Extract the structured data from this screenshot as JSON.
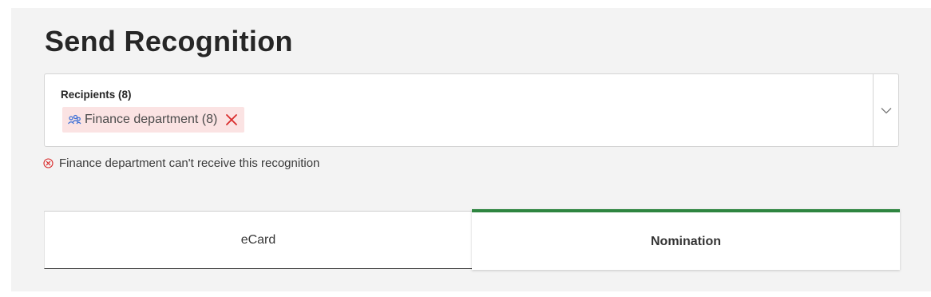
{
  "header": {
    "title": "Send Recognition"
  },
  "recipients": {
    "label": "Recipients (8)",
    "chips": [
      {
        "label": "Finance department (8)",
        "icon": "group-icon",
        "remove_icon": "close-icon"
      }
    ],
    "dropdown_icon": "chevron-down-icon"
  },
  "error": {
    "icon": "error-circle-icon",
    "message": "Finance department can't receive this recognition"
  },
  "tabs": [
    {
      "label": "eCard",
      "selected": false
    },
    {
      "label": "Nomination",
      "selected": true
    }
  ],
  "colors": {
    "accent": "#2e8540",
    "chip_background": "#fbe3e3",
    "error_red": "#d92b2b",
    "group_icon_blue": "#3b6fd6"
  }
}
